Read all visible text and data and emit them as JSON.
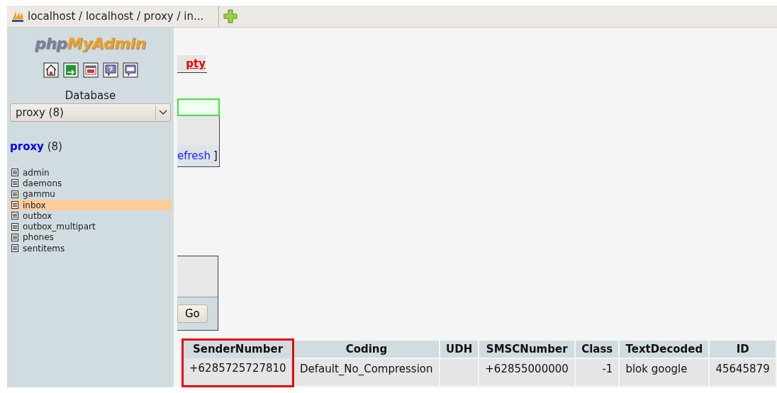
{
  "browser_tab": {
    "title": "localhost / localhost / proxy / in..."
  },
  "sidebar": {
    "logo": {
      "part_1": "php",
      "part_2": "MyAdmin"
    },
    "toolbar": [
      {
        "kind": "home"
      },
      {
        "kind": "exit"
      },
      {
        "kind": "sql_window"
      },
      {
        "kind": "help"
      },
      {
        "kind": "sql_query"
      }
    ],
    "database_label": "Database",
    "database_select": {
      "value": "proxy (8)"
    },
    "db_name": "proxy",
    "db_count": "(8)",
    "tables": [
      {
        "name": "admin",
        "selected": false
      },
      {
        "name": "daemons",
        "selected": false
      },
      {
        "name": "gammu",
        "selected": false
      },
      {
        "name": "inbox",
        "selected": true
      },
      {
        "name": "outbox",
        "selected": false
      },
      {
        "name": "outbox_multipart",
        "selected": false
      },
      {
        "name": "phones",
        "selected": false
      },
      {
        "name": "sentitems",
        "selected": false
      }
    ]
  },
  "main": {
    "tab_fragment": "pty",
    "refresh_fragment": "efresh",
    "bracket": "]",
    "go_button": "Go",
    "table": {
      "columns": [
        {
          "label": "SenderNumber",
          "highlighted": true
        },
        {
          "label": "Coding",
          "highlighted": false
        },
        {
          "label": "UDH",
          "highlighted": false
        },
        {
          "label": "SMSCNumber",
          "highlighted": false
        },
        {
          "label": "Class",
          "highlighted": false
        },
        {
          "label": "TextDecoded",
          "highlighted": false
        },
        {
          "label": "ID",
          "highlighted": false
        }
      ],
      "rows": [
        [
          "+6285725727810",
          "Default_No_Compression",
          "",
          "+62855000000",
          "-1",
          "blok google",
          "45645879"
        ]
      ]
    }
  }
}
